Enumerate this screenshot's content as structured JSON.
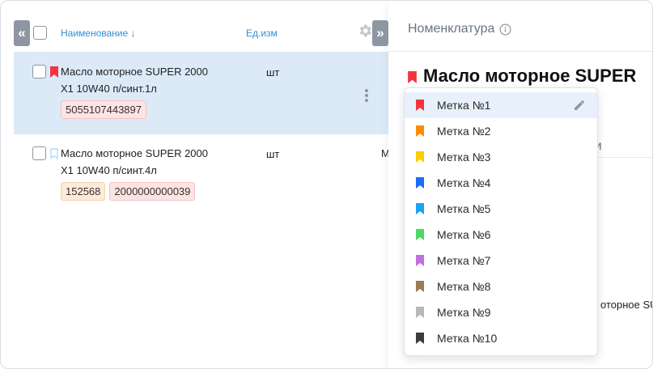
{
  "list": {
    "columns": {
      "name": "Наименование ↓",
      "unit": "Ед.изм"
    },
    "rows": [
      {
        "name_line1": "Масло моторное SUPER 2000",
        "name_line2": "X1 10W40 п/синт.1л",
        "unit": "шт",
        "barcodes": [
          "5055107443897"
        ],
        "flag_color": "#f5333f"
      },
      {
        "name_line1": "Масло моторное SUPER 2000",
        "name_line2": "X1 10W40 п/синт.4л",
        "unit": "шт",
        "article": "152568",
        "barcodes": [
          "2000000000039"
        ],
        "flag_color": "#b9d8f5"
      }
    ],
    "clipped_text": "М"
  },
  "panel": {
    "title": "Номенклатура",
    "item_title": "Масло моторное SUPER",
    "tab_fragment": "оги",
    "text_fragment": "оторное SUF"
  },
  "label_menu": {
    "items": [
      {
        "label": "Метка №1",
        "color": "#f5333f"
      },
      {
        "label": "Метка №2",
        "color": "#ff8c00"
      },
      {
        "label": "Метка №3",
        "color": "#ffcc00"
      },
      {
        "label": "Метка №4",
        "color": "#1a6ef5"
      },
      {
        "label": "Метка №5",
        "color": "#1aa3f5"
      },
      {
        "label": "Метка №6",
        "color": "#4cd964"
      },
      {
        "label": "Метка №7",
        "color": "#c36ee0"
      },
      {
        "label": "Метка №8",
        "color": "#9c7a52"
      },
      {
        "label": "Метка №9",
        "color": "#b9b9b9"
      },
      {
        "label": "Метка №10",
        "color": "#3c3c3c"
      }
    ]
  }
}
